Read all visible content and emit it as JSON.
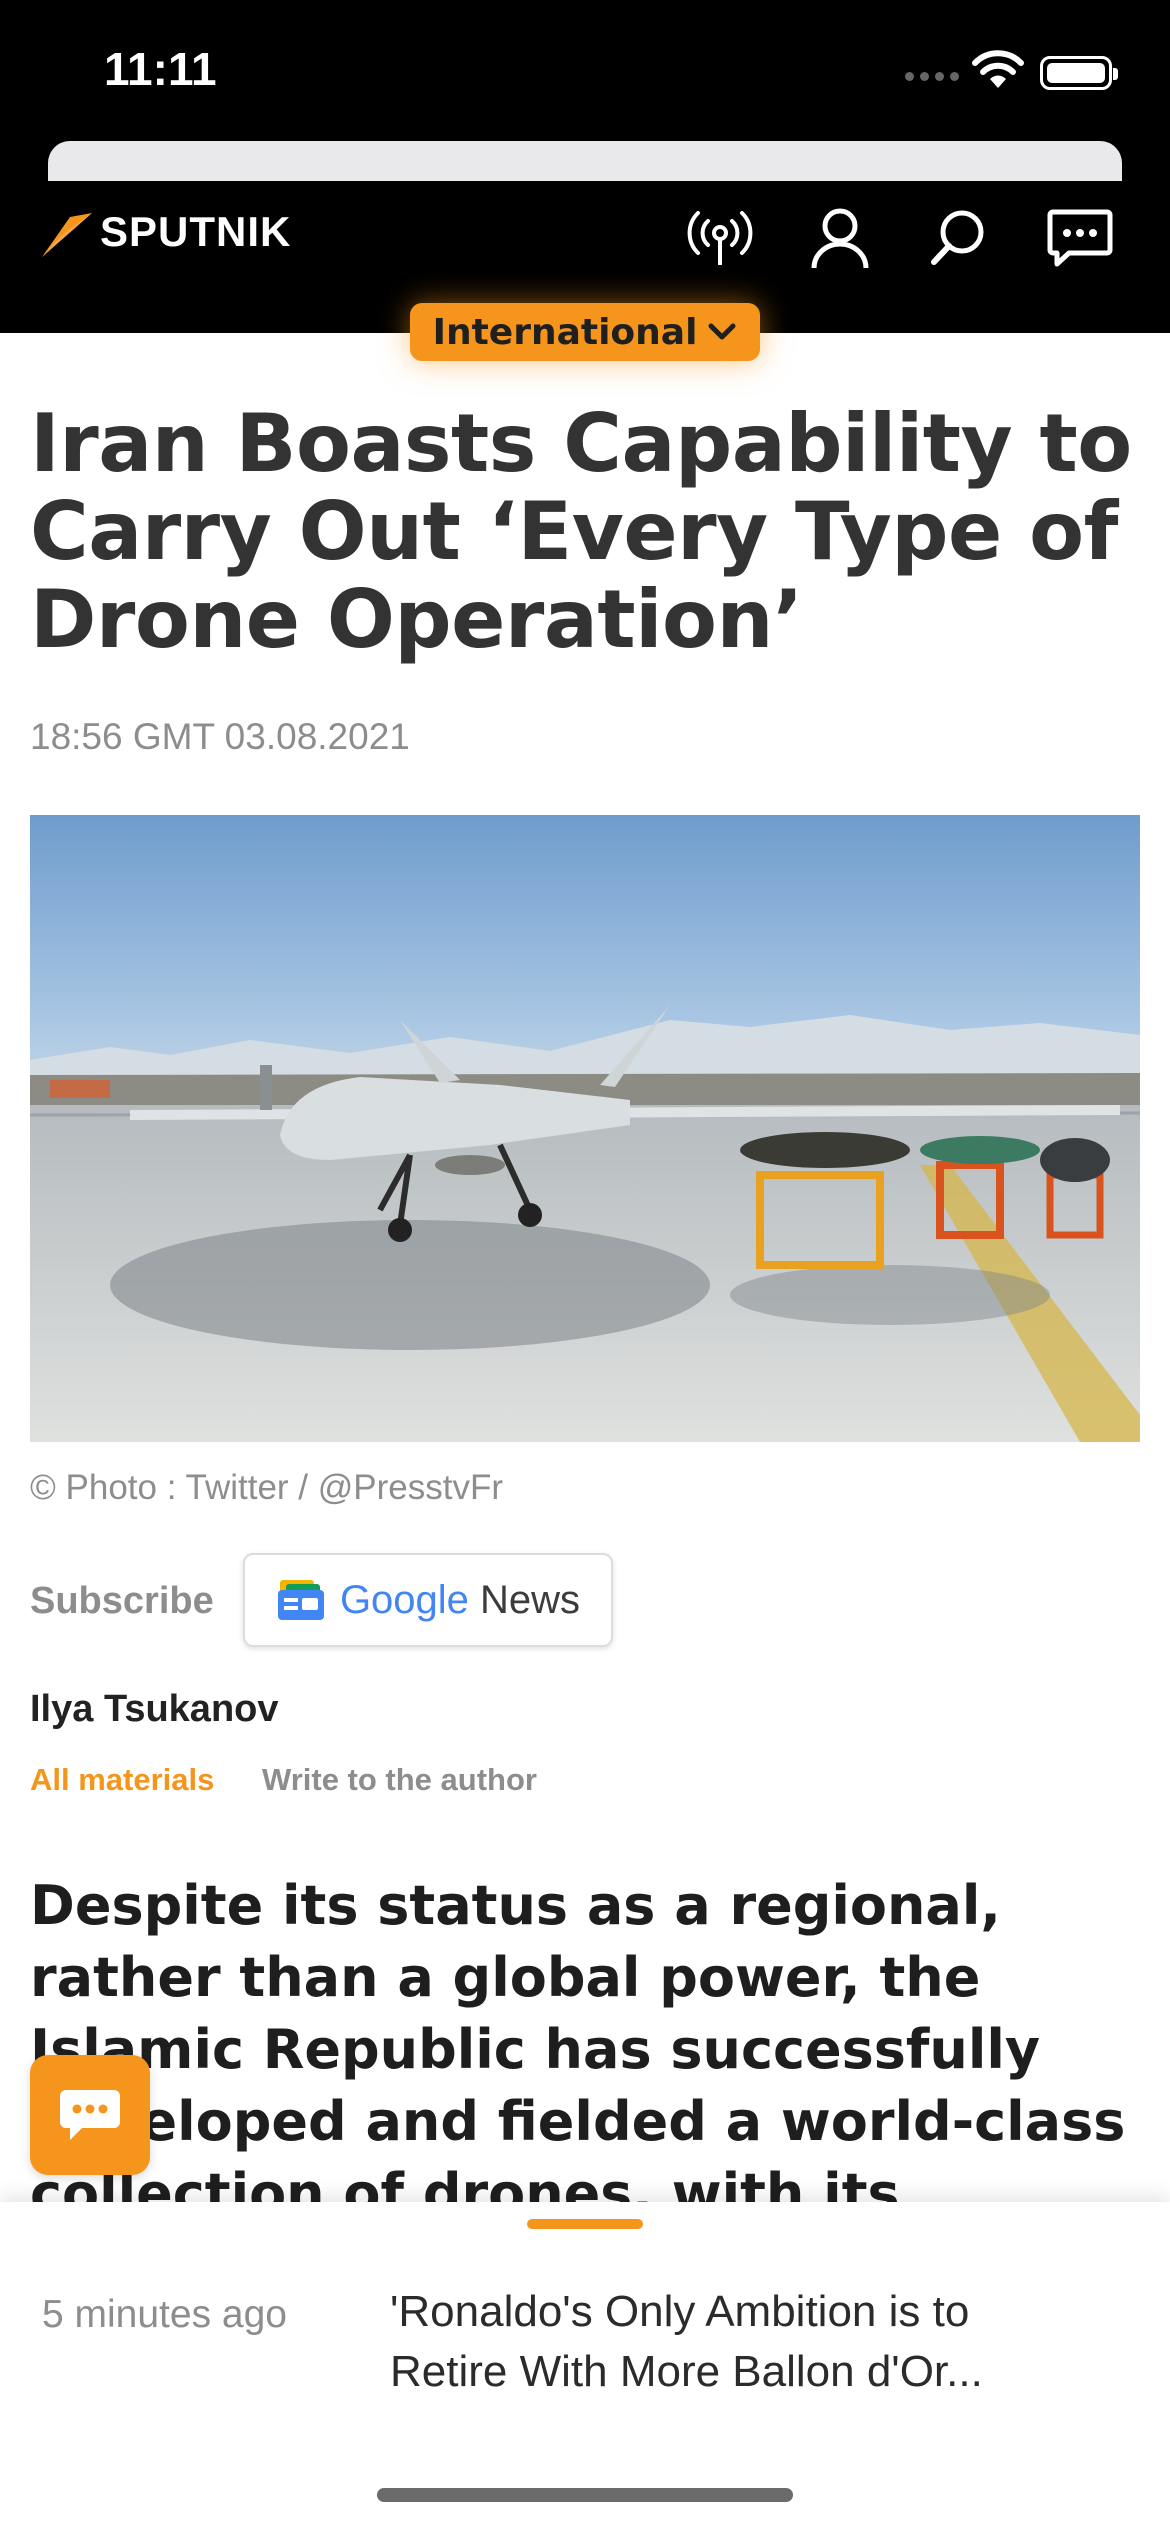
{
  "status_bar": {
    "time": "11:11"
  },
  "brand": {
    "name": "SPUTNIK",
    "accent_color": "#f5951c"
  },
  "header_icons": [
    "radio-icon",
    "user-icon",
    "search-icon",
    "chat-icon"
  ],
  "edition": {
    "label": "International"
  },
  "article": {
    "title": "Iran Boasts Capability to Carry Out ‘Every Type of Drone Operation’",
    "datetime": "18:56 GMT 03.08.2021",
    "photo_credit": "© Photo : Twitter / @PresstvFr",
    "subscribe_label": "Subscribe",
    "subscribe_service_prefix": "Google",
    "subscribe_service_suffix": " News",
    "author": "Ilya Tsukanov",
    "all_materials": "All materials",
    "write_to_author": "Write to the author",
    "lead": "Despite its status as a regional, rather than a global power, the Islamic Republic has successfully developed and fielded a world-class collection of drones, with its designs ranging from"
  },
  "bottom_news": {
    "time": "5 minutes ago",
    "title": "'Ronaldo's Only Ambition is to Retire With More Ballon d'Or..."
  }
}
